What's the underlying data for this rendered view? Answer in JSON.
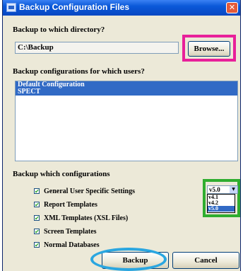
{
  "window": {
    "title": "Backup Configuration Files",
    "close_glyph": "✕"
  },
  "directory": {
    "label": "Backup to which directory?",
    "value": "C:\\Backup",
    "browse_label": "Browse..."
  },
  "users": {
    "label": "Backup configurations for which users?",
    "items": [
      {
        "label": "Default Configuration",
        "selected": true
      },
      {
        "label": "SPECT",
        "selected": true
      }
    ]
  },
  "configs": {
    "label": "Backup which configurations",
    "check_glyph": "✔",
    "options": [
      {
        "label": "General User Specific Settings",
        "checked": true
      },
      {
        "label": "Report Templates",
        "checked": true
      },
      {
        "label": "XML Templates (XSL Files)",
        "checked": true
      },
      {
        "label": "Screen Templates",
        "checked": true
      },
      {
        "label": "Normal Databases",
        "checked": true
      }
    ]
  },
  "version_select": {
    "value": "v5.0",
    "arrow_glyph": "▼",
    "options": [
      {
        "label": "v4.1",
        "selected": false
      },
      {
        "label": "v4.2",
        "selected": false
      },
      {
        "label": "v5.0",
        "selected": true
      }
    ]
  },
  "footer": {
    "backup_label": "Backup",
    "cancel_label": "Cancel"
  },
  "highlight_colors": {
    "pink": "#e8209a",
    "green": "#2fad2f",
    "blue": "#2aa6e0"
  }
}
